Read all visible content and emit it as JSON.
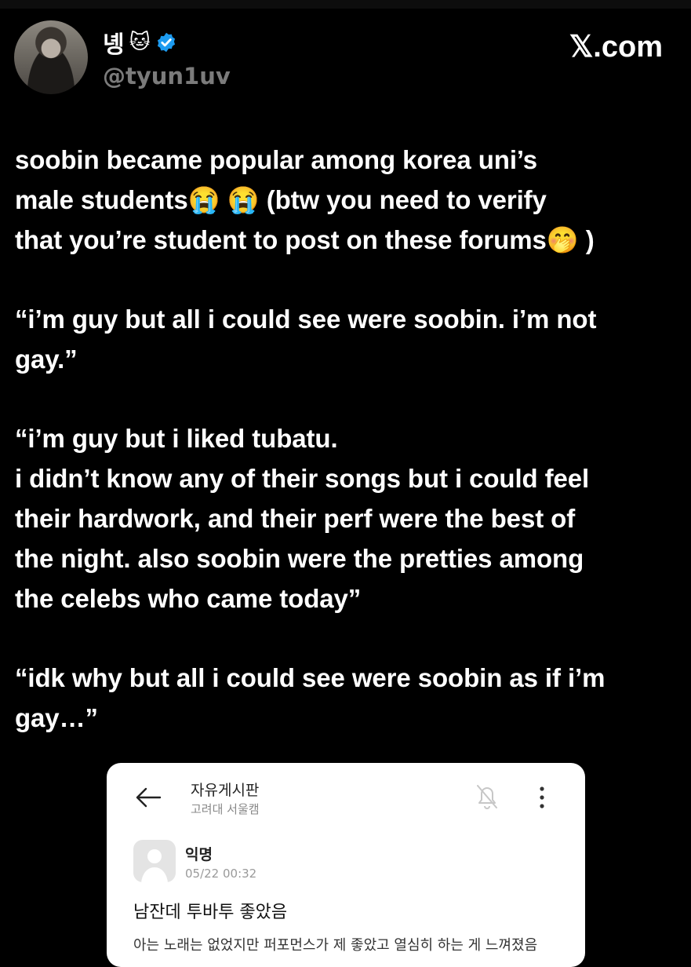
{
  "header": {
    "display_name": "녱",
    "name_emoji": "🐱",
    "verified_icon": "verified-badge-icon",
    "handle": "@tyun1uv",
    "brand": "𝕏.com",
    "accent_color": "#1d9bf0"
  },
  "tweet": {
    "paragraphs": [
      {
        "lines": [
          "soobin became popular among korea uni’s",
          "male students😭 😭  (btw you need to verify",
          "that you’re student to post on these forums🤭 )"
        ]
      },
      {
        "lines": [
          "“i’m guy but all i could see were soobin. i’m not",
          "gay.”"
        ]
      },
      {
        "lines": [
          "“i’m guy but i liked tubatu.",
          "i didn’t know any of their songs but i could feel",
          "their hardwork, and their perf were the best of",
          "the night. also soobin were the pretties among",
          "the celebs who came today”"
        ]
      },
      {
        "lines": [
          "“idk why but all i could see were soobin as if i’m",
          "gay…”"
        ]
      }
    ]
  },
  "embedded_screenshot": {
    "board_title": "자유게시판",
    "board_subtitle": "고려대 서울캠",
    "author": "익명",
    "date": "05/22 00:32",
    "post_title": "남잔데 투바투 좋았음",
    "post_body": "아는 노래는 없었지만 퍼포먼스가 제 좋았고 열심히 하는 게 느껴졌음"
  }
}
